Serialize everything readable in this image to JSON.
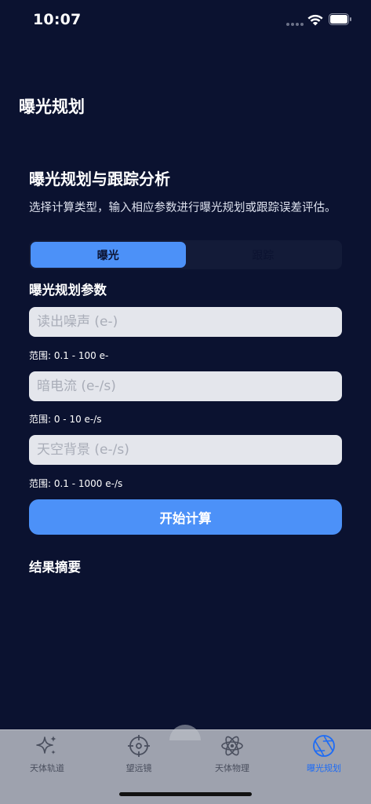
{
  "status_bar": {
    "time": "10:07"
  },
  "page": {
    "title": "曝光规划"
  },
  "section": {
    "title": "曝光规划与跟踪分析",
    "description": "选择计算类型，输入相应参数进行曝光规划或跟踪误差评估。"
  },
  "segmented": {
    "options": [
      {
        "label": "曝光",
        "selected": true
      },
      {
        "label": "跟踪",
        "selected": false
      }
    ]
  },
  "params": {
    "title": "曝光规划参数",
    "fields": [
      {
        "placeholder": "读出噪声 (e-)",
        "value": "",
        "hint": "范围: 0.1 - 100 e-"
      },
      {
        "placeholder": "暗电流 (e-/s)",
        "value": "",
        "hint": "范围: 0 - 10 e-/s"
      },
      {
        "placeholder": "天空背景 (e-/s)",
        "value": "",
        "hint": "范围: 0.1 - 1000 e-/s"
      }
    ]
  },
  "compute_button": {
    "label": "开始计算"
  },
  "results": {
    "title": "结果摘要"
  },
  "tab_bar": {
    "items": [
      {
        "label": "天体轨道",
        "icon": "sparkles-icon",
        "active": false
      },
      {
        "label": "望远镜",
        "icon": "scope-icon",
        "active": false
      },
      {
        "label": "天体物理",
        "icon": "atom-icon",
        "active": false
      },
      {
        "label": "曝光规划",
        "icon": "aperture-icon",
        "active": true
      }
    ]
  },
  "colors": {
    "background": "#0b1230",
    "accent": "#4c91f8",
    "tab_active": "#1e6cf5",
    "tab_inactive": "#4a4f5e"
  }
}
